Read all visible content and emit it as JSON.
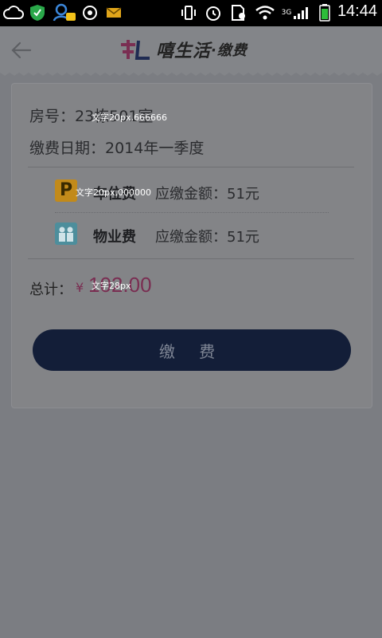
{
  "status_bar": {
    "time": "14:44",
    "network_type": "3G",
    "icons": [
      "cloud-icon",
      "shield-icon",
      "chat-person-icon",
      "browser-icon",
      "mail-icon",
      "vibrate-icon",
      "alarm-icon",
      "sim-icon",
      "wifi-icon",
      "signal-icon",
      "battery-icon"
    ]
  },
  "header": {
    "brand_name": "嘻生活",
    "brand_sub": "·缴费",
    "back_icon": "arrow-left-icon"
  },
  "bill": {
    "room_text": "房号：23栋501室",
    "room_overlay": "文字20px,666666",
    "date_text": "缴费日期：2014年一季度",
    "items": [
      {
        "icon": "parking-icon",
        "icon_letter": "P",
        "name": "车位费",
        "amount": "应缴金额：51元",
        "overlay": "文字20px,000000",
        "icon_color": "#c28a1a"
      },
      {
        "icon": "people-icon",
        "name": "物业费",
        "amount": "应缴金额：51元",
        "icon_color": "#4d8e9c"
      }
    ],
    "total_label": "总计：",
    "total_currency": "¥",
    "total_value": "102.00",
    "total_overlay": "文字28px",
    "pay_button": "缴 费"
  },
  "colors": {
    "accent": "#7a2e52",
    "button": "#131e38"
  }
}
